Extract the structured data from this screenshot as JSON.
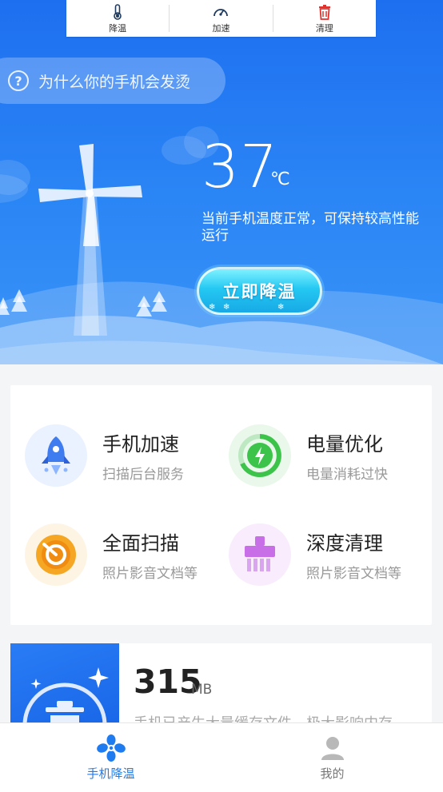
{
  "top_tabs": [
    {
      "label": "降温",
      "icon": "thermometer-icon"
    },
    {
      "label": "加速",
      "icon": "speedometer-icon"
    },
    {
      "label": "清理",
      "icon": "trash-icon"
    }
  ],
  "hero": {
    "why_text": "为什么你的手机会发烫",
    "temperature": "37",
    "unit": "℃",
    "status": "当前手机温度正常，可保持较高性能运行",
    "cool_button": "立即降温"
  },
  "features": [
    {
      "title": "手机加速",
      "subtitle": "扫描后台服务",
      "icon": "rocket-icon",
      "color": "#3f7cf0",
      "bg": "#eaf2ff"
    },
    {
      "title": "电量优化",
      "subtitle": "电量消耗过快",
      "icon": "battery-bolt-icon",
      "color": "#3cc44a",
      "bg": "#e9f8ea"
    },
    {
      "title": "全面扫描",
      "subtitle": "照片影音文档等",
      "icon": "scan-icon",
      "color": "#f5a623",
      "bg": "#fdf4e3"
    },
    {
      "title": "深度清理",
      "subtitle": "照片影音文档等",
      "icon": "brush-icon",
      "color": "#c86ee6",
      "bg": "#f8ecfd"
    }
  ],
  "cache": {
    "size": "315",
    "unit": "MB",
    "description": "手机已产生大量缓存文件，极大影响内存"
  },
  "bottom_nav": [
    {
      "label": "手机降温",
      "icon": "fan-icon",
      "active": true
    },
    {
      "label": "我的",
      "icon": "user-icon",
      "active": false
    }
  ],
  "colors": {
    "primary": "#2b86f5",
    "active_nav": "#1f7cf0",
    "inactive_nav": "#888888"
  }
}
